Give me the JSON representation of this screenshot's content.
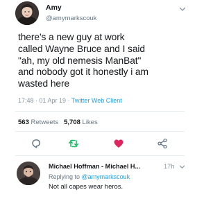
{
  "tweet": {
    "author_name": "Amy",
    "author_handle": "@amymarkscouk",
    "text": "there's a new guy at work\ncalled Wayne Bruce and I said\n\"ah, my old nemesis ManBat\"\nand nobody got it honestly i am\nwasted here",
    "timestamp": "17:48 · 01 Apr 19 · ",
    "client": "Twitter Web Client",
    "retweets_count": "563",
    "retweets_label": " Retweets",
    "likes_count": "5,708",
    "likes_label": " Likes",
    "menu_icon": "chevron-down-icon"
  },
  "actions": [
    {
      "icon": "reply-icon",
      "color": "#657786"
    },
    {
      "icon": "retweet-icon",
      "color": "#17bf63"
    },
    {
      "icon": "like-heart-icon",
      "color": "#e0245e"
    },
    {
      "icon": "share-icon",
      "color": "#657786"
    }
  ],
  "reply": {
    "author_name": "Michael Hoffman - Michael H...",
    "time": "17h",
    "replying_prefix": "Replying to ",
    "replying_to": "@amymarkscouk",
    "text": "Not all capes wear heros."
  },
  "colors": {
    "accent": "#1da1f2",
    "muted": "#657786",
    "retweet_active": "#17bf63",
    "like_active": "#e0245e"
  }
}
